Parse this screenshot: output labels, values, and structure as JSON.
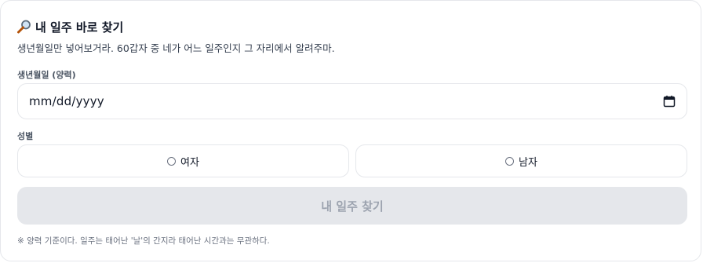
{
  "header": {
    "title": "내 일주 바로 찾기",
    "subtitle": "생년월일만 넣어보거라. 60갑자 중 네가 어느 일주인지 그 자리에서 알려주마."
  },
  "form": {
    "birthdate_label": "생년월일 (양력)",
    "birthdate_value": "mm/dd/yyyy",
    "gender_label": "성별",
    "gender_options": [
      "여자",
      "남자"
    ],
    "submit_label": "내 일주 찾기"
  },
  "footnote": "※ 양력 기준이다. 일주는 태어난 '날'의 간지라 태어난 시간과는 무관하다.",
  "icons": {
    "title_icon": "magnifier-icon",
    "date_icon": "calendar-icon"
  }
}
